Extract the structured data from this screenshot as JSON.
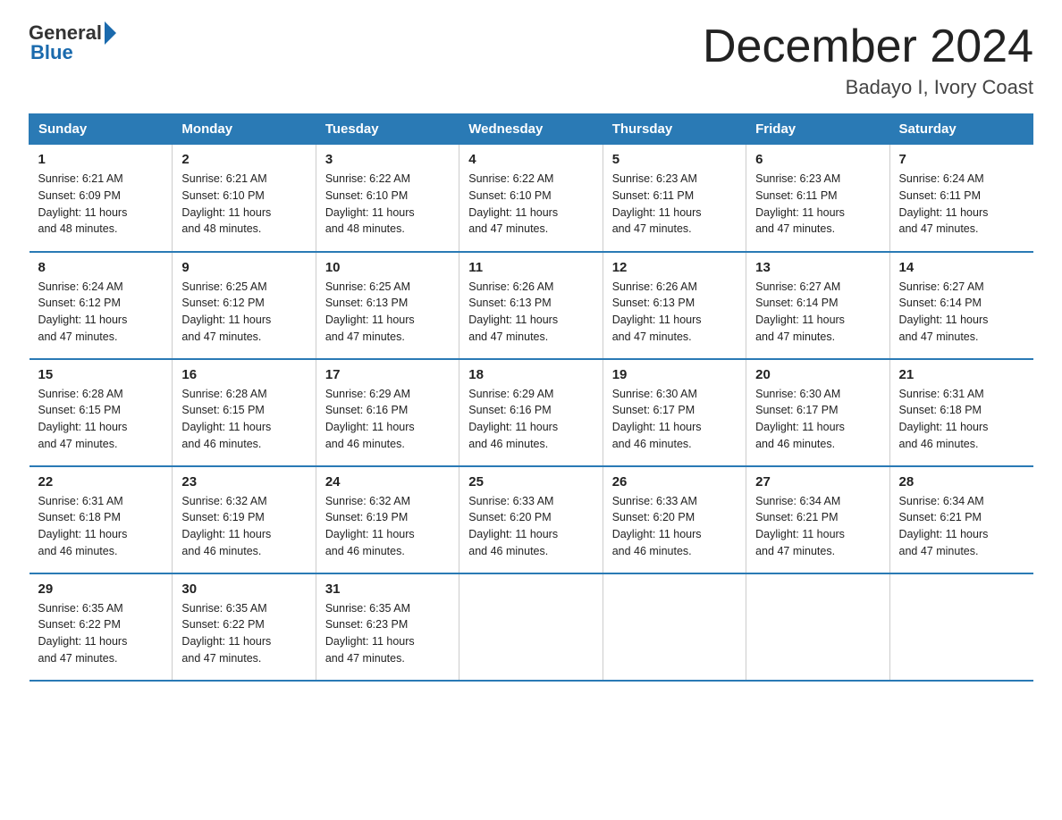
{
  "logo": {
    "general": "General",
    "blue": "Blue",
    "arrow": "▶"
  },
  "header": {
    "month": "December 2024",
    "location": "Badayo I, Ivory Coast"
  },
  "weekdays": [
    "Sunday",
    "Monday",
    "Tuesday",
    "Wednesday",
    "Thursday",
    "Friday",
    "Saturday"
  ],
  "weeks": [
    [
      {
        "day": "1",
        "sunrise": "6:21 AM",
        "sunset": "6:09 PM",
        "daylight": "11 hours and 48 minutes."
      },
      {
        "day": "2",
        "sunrise": "6:21 AM",
        "sunset": "6:10 PM",
        "daylight": "11 hours and 48 minutes."
      },
      {
        "day": "3",
        "sunrise": "6:22 AM",
        "sunset": "6:10 PM",
        "daylight": "11 hours and 48 minutes."
      },
      {
        "day": "4",
        "sunrise": "6:22 AM",
        "sunset": "6:10 PM",
        "daylight": "11 hours and 47 minutes."
      },
      {
        "day": "5",
        "sunrise": "6:23 AM",
        "sunset": "6:11 PM",
        "daylight": "11 hours and 47 minutes."
      },
      {
        "day": "6",
        "sunrise": "6:23 AM",
        "sunset": "6:11 PM",
        "daylight": "11 hours and 47 minutes."
      },
      {
        "day": "7",
        "sunrise": "6:24 AM",
        "sunset": "6:11 PM",
        "daylight": "11 hours and 47 minutes."
      }
    ],
    [
      {
        "day": "8",
        "sunrise": "6:24 AM",
        "sunset": "6:12 PM",
        "daylight": "11 hours and 47 minutes."
      },
      {
        "day": "9",
        "sunrise": "6:25 AM",
        "sunset": "6:12 PM",
        "daylight": "11 hours and 47 minutes."
      },
      {
        "day": "10",
        "sunrise": "6:25 AM",
        "sunset": "6:13 PM",
        "daylight": "11 hours and 47 minutes."
      },
      {
        "day": "11",
        "sunrise": "6:26 AM",
        "sunset": "6:13 PM",
        "daylight": "11 hours and 47 minutes."
      },
      {
        "day": "12",
        "sunrise": "6:26 AM",
        "sunset": "6:13 PM",
        "daylight": "11 hours and 47 minutes."
      },
      {
        "day": "13",
        "sunrise": "6:27 AM",
        "sunset": "6:14 PM",
        "daylight": "11 hours and 47 minutes."
      },
      {
        "day": "14",
        "sunrise": "6:27 AM",
        "sunset": "6:14 PM",
        "daylight": "11 hours and 47 minutes."
      }
    ],
    [
      {
        "day": "15",
        "sunrise": "6:28 AM",
        "sunset": "6:15 PM",
        "daylight": "11 hours and 47 minutes."
      },
      {
        "day": "16",
        "sunrise": "6:28 AM",
        "sunset": "6:15 PM",
        "daylight": "11 hours and 46 minutes."
      },
      {
        "day": "17",
        "sunrise": "6:29 AM",
        "sunset": "6:16 PM",
        "daylight": "11 hours and 46 minutes."
      },
      {
        "day": "18",
        "sunrise": "6:29 AM",
        "sunset": "6:16 PM",
        "daylight": "11 hours and 46 minutes."
      },
      {
        "day": "19",
        "sunrise": "6:30 AM",
        "sunset": "6:17 PM",
        "daylight": "11 hours and 46 minutes."
      },
      {
        "day": "20",
        "sunrise": "6:30 AM",
        "sunset": "6:17 PM",
        "daylight": "11 hours and 46 minutes."
      },
      {
        "day": "21",
        "sunrise": "6:31 AM",
        "sunset": "6:18 PM",
        "daylight": "11 hours and 46 minutes."
      }
    ],
    [
      {
        "day": "22",
        "sunrise": "6:31 AM",
        "sunset": "6:18 PM",
        "daylight": "11 hours and 46 minutes."
      },
      {
        "day": "23",
        "sunrise": "6:32 AM",
        "sunset": "6:19 PM",
        "daylight": "11 hours and 46 minutes."
      },
      {
        "day": "24",
        "sunrise": "6:32 AM",
        "sunset": "6:19 PM",
        "daylight": "11 hours and 46 minutes."
      },
      {
        "day": "25",
        "sunrise": "6:33 AM",
        "sunset": "6:20 PM",
        "daylight": "11 hours and 46 minutes."
      },
      {
        "day": "26",
        "sunrise": "6:33 AM",
        "sunset": "6:20 PM",
        "daylight": "11 hours and 46 minutes."
      },
      {
        "day": "27",
        "sunrise": "6:34 AM",
        "sunset": "6:21 PM",
        "daylight": "11 hours and 47 minutes."
      },
      {
        "day": "28",
        "sunrise": "6:34 AM",
        "sunset": "6:21 PM",
        "daylight": "11 hours and 47 minutes."
      }
    ],
    [
      {
        "day": "29",
        "sunrise": "6:35 AM",
        "sunset": "6:22 PM",
        "daylight": "11 hours and 47 minutes."
      },
      {
        "day": "30",
        "sunrise": "6:35 AM",
        "sunset": "6:22 PM",
        "daylight": "11 hours and 47 minutes."
      },
      {
        "day": "31",
        "sunrise": "6:35 AM",
        "sunset": "6:23 PM",
        "daylight": "11 hours and 47 minutes."
      },
      null,
      null,
      null,
      null
    ]
  ],
  "labels": {
    "sunrise": "Sunrise:",
    "sunset": "Sunset:",
    "daylight": "Daylight:"
  }
}
